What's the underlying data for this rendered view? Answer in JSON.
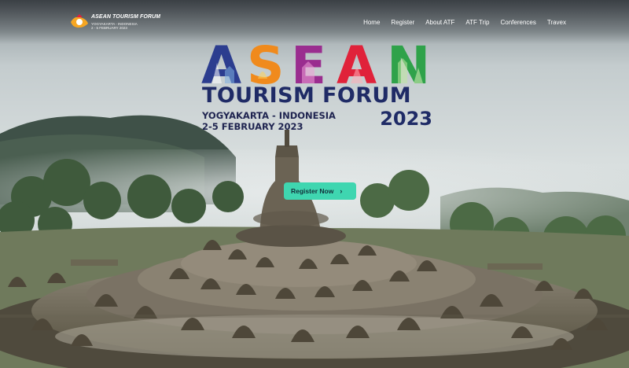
{
  "logo": {
    "title": "ASEAN TOURISM FORUM",
    "subtitle_line1": "YOGYAKARTA - INDONESIA",
    "subtitle_line2": "2 - 5 FEBRUARY 2023"
  },
  "nav": {
    "items": [
      {
        "label": "Home"
      },
      {
        "label": "Register"
      },
      {
        "label": "About ATF"
      },
      {
        "label": "ATF Trip"
      },
      {
        "label": "Conferences"
      },
      {
        "label": "Travex"
      }
    ]
  },
  "hero": {
    "asean_letters": [
      "A",
      "S",
      "E",
      "A",
      "N"
    ],
    "title_line": "TOURISM FORUM",
    "location": "YOGYAKARTA - INDONESIA",
    "dates": "2-5 FEBRUARY 2023",
    "year": "2023"
  },
  "cta": {
    "label": "Register Now",
    "icon": "chevron-right-icon",
    "color": "#3fd6b0"
  },
  "colors": {
    "letter_a1": "#2c3d8f",
    "letter_s": "#f08a1c",
    "letter_e": "#9a2d8f",
    "letter_a2": "#e0223a",
    "letter_n": "#2fa24a",
    "title_navy": "#1f2b66"
  }
}
